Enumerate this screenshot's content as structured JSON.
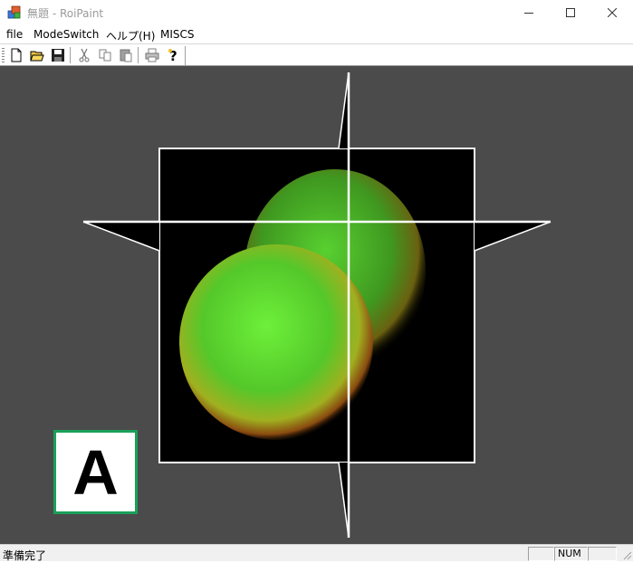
{
  "window": {
    "title": "無題 - RoiPaint",
    "app_icon": "paint-app-icon"
  },
  "menu": {
    "items": [
      {
        "label": "file"
      },
      {
        "label": "ModeSwitch"
      },
      {
        "label": "ヘルプ(H)"
      },
      {
        "label": "MISCS"
      }
    ]
  },
  "toolbar": {
    "buttons": [
      {
        "icon": "new-file-icon"
      },
      {
        "icon": "open-folder-icon"
      },
      {
        "icon": "save-icon"
      },
      {
        "icon": "cut-icon"
      },
      {
        "icon": "copy-icon"
      },
      {
        "icon": "paste-icon"
      },
      {
        "icon": "print-icon"
      },
      {
        "icon": "help-icon"
      }
    ]
  },
  "canvas": {
    "background": "#4b4b4b",
    "overlay_label": "A",
    "overlay_border_color": "#1aa05a",
    "crosshair_color": "#ffffff"
  },
  "status": {
    "text": "準備完了",
    "panes": [
      "",
      "NUM",
      ""
    ]
  }
}
